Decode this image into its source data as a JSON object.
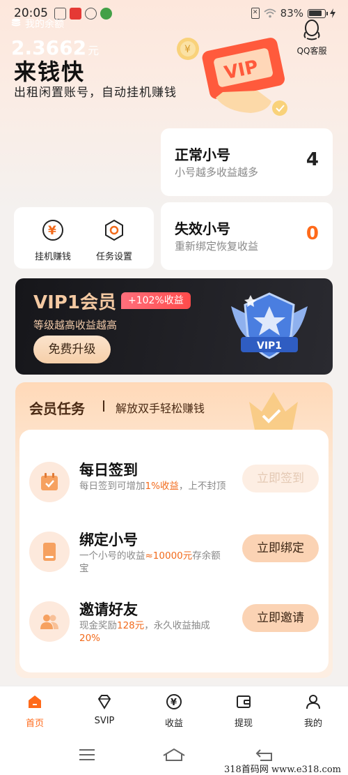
{
  "status_bar": {
    "time": "20:05",
    "battery": "83%"
  },
  "header": {
    "title": "来钱快",
    "subtitle": "出租闲置账号，自动挂机赚钱",
    "qq_service_label": "QQ客服",
    "illustration_text": "VIP"
  },
  "balance": {
    "label": "我的余额",
    "value": "2.3662",
    "unit": "元"
  },
  "accounts": {
    "normal": {
      "title": "正常小号",
      "desc": "小号越多收益越多",
      "count": "4"
    },
    "invalid": {
      "title": "失效小号",
      "desc": "重新绑定恢复收益",
      "count": "0"
    }
  },
  "tools": {
    "hang": "挂机赚钱",
    "task_settings": "任务设置"
  },
  "vip_banner": {
    "title": "VIP1会员",
    "tag": "+102%收益",
    "desc": "等级越高收益越高",
    "button": "免费升级",
    "badge_text": "VIP1"
  },
  "tasks": {
    "title": "会员任务",
    "subtitle": "解放双手轻松赚钱",
    "items": [
      {
        "title": "每日签到",
        "desc_pre": "每日签到可增加",
        "desc_hl": "1%收益",
        "desc_post": "，上不封顶",
        "button": "立即签到"
      },
      {
        "title": "绑定小号",
        "desc_pre": "一个小号的收益",
        "desc_hl": "≈10000元",
        "desc_post": "存余额宝",
        "button": "立即绑定"
      },
      {
        "title": "邀请好友",
        "desc_pre": "现金奖励",
        "desc_hl": "128元",
        "desc_post": "，永久收益抽成",
        "desc_hl2": "20%",
        "button": "立即邀请"
      }
    ]
  },
  "bottom_nav": [
    {
      "label": "首页"
    },
    {
      "label": "SVIP"
    },
    {
      "label": "收益"
    },
    {
      "label": "提现"
    },
    {
      "label": "我的"
    }
  ],
  "watermark": "318首码网  www.e318.com",
  "colors": {
    "accent": "#ff6a1a",
    "gold": "#f4c9a2",
    "highlight": "#f26a1b"
  }
}
